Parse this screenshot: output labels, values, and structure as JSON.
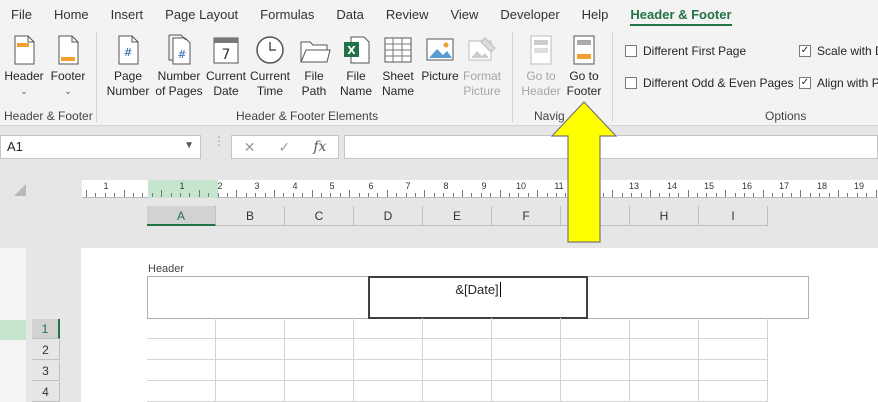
{
  "menu": {
    "tabs": [
      "File",
      "Home",
      "Insert",
      "Page Layout",
      "Formulas",
      "Data",
      "Review",
      "View",
      "Developer",
      "Help",
      "Header & Footer"
    ],
    "active": "Header & Footer"
  },
  "ribbon": {
    "header_btn": "Header",
    "footer_btn": "Footer",
    "page_number": [
      "Page",
      "Number"
    ],
    "number_of_pages": [
      "Number",
      "of Pages"
    ],
    "current_date": [
      "Current",
      "Date"
    ],
    "current_time": [
      "Current",
      "Time"
    ],
    "file_path": [
      "File",
      "Path"
    ],
    "file_name": [
      "File",
      "Name"
    ],
    "sheet_name": [
      "Sheet",
      "Name"
    ],
    "picture": "Picture",
    "format_picture": [
      "Format",
      "Picture"
    ],
    "go_to_header": [
      "Go to",
      "Header"
    ],
    "go_to_footer": [
      "Go to",
      "Footer"
    ],
    "group_hf": "Header & Footer",
    "group_elements": "Header & Footer Elements",
    "group_nav": "Navig",
    "group_options": "Options",
    "opt_first_page": "Different First Page",
    "opt_odd_even": "Different Odd & Even Pages",
    "opt_scale": "Scale with D",
    "opt_align": "Align with P",
    "opt_check": "✓"
  },
  "formula_bar": {
    "name_box": "A1",
    "cancel": "✕",
    "enter": "✓",
    "fx": "fx",
    "formula": ""
  },
  "ruler": {
    "labels": [
      "1",
      "1",
      "2",
      "3",
      "4",
      "5",
      "6",
      "7",
      "8",
      "9",
      "10",
      "11",
      "12",
      "13",
      "14",
      "15",
      "16",
      "17",
      "18",
      "19"
    ]
  },
  "columns": [
    "A",
    "B",
    "C",
    "D",
    "E",
    "F",
    "G",
    "H",
    "I"
  ],
  "rows": [
    "1",
    "2",
    "3",
    "4"
  ],
  "header_area": {
    "label": "Header",
    "center_text": "&[Date]"
  },
  "colors": {
    "accent": "#217346",
    "arrow_fill": "#ffff00"
  }
}
